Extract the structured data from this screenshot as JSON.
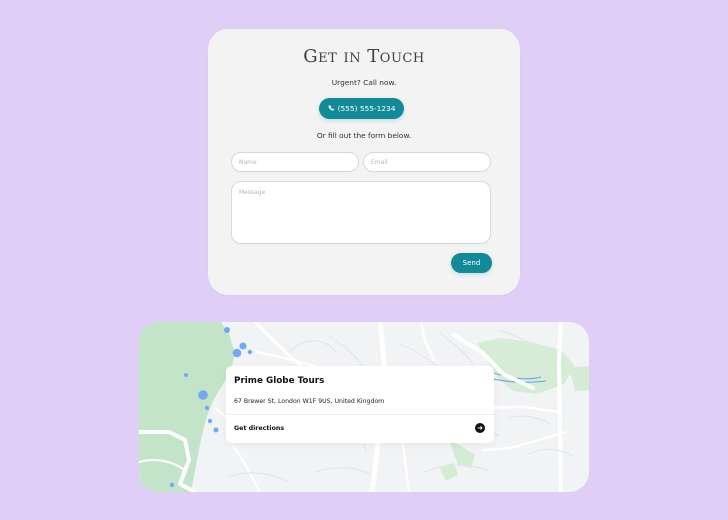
{
  "contact": {
    "title": "Get in Touch",
    "urgent_text": "Urgent? Call now.",
    "phone_label": "(555) 555-1234",
    "form_note": "Or fill out the form below.",
    "name_placeholder": "Name",
    "email_placeholder": "Email",
    "message_placeholder": "Message",
    "send_label": "Send"
  },
  "location": {
    "name": "Prime Globe Tours",
    "address": "67 Brewer St, London W1F 9US, United Kingdom",
    "directions_label": "Get directions",
    "directions_icon": "arrow-right-circle-icon"
  },
  "colors": {
    "background": "#dfcff7",
    "card": "#f3f3f3",
    "accent": "#138a98",
    "map_green": "#bfe3c4",
    "map_water": "#6aa6f3"
  }
}
